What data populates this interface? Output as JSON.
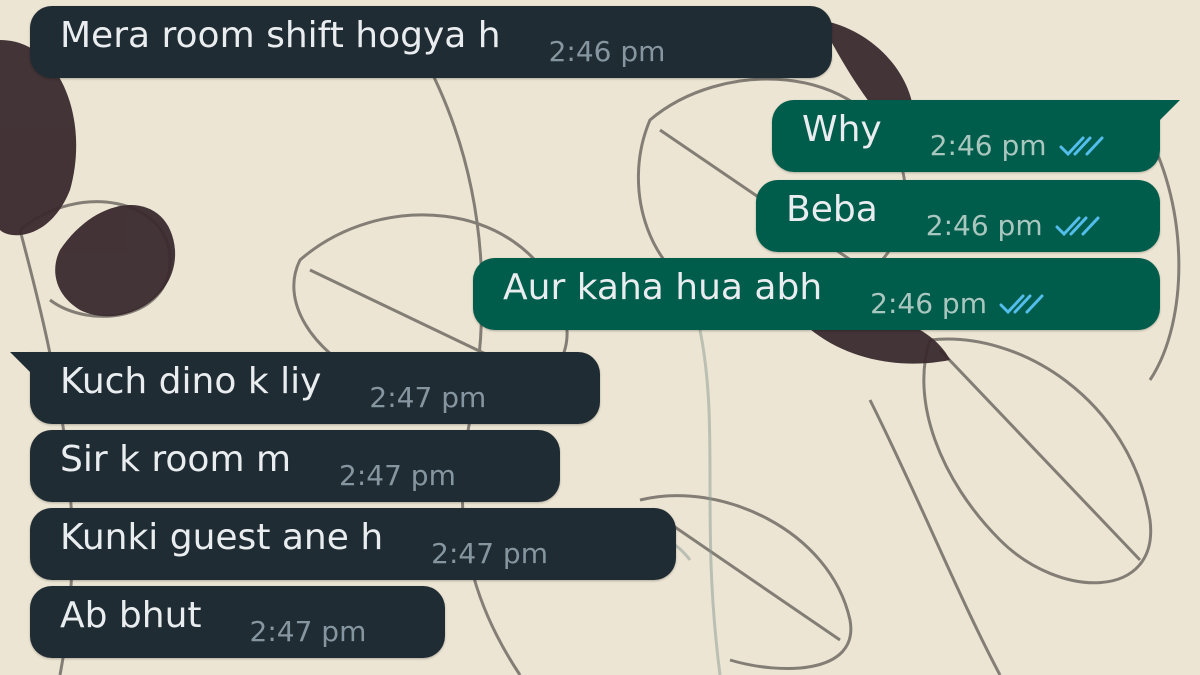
{
  "colors": {
    "wallpaper": "#ece5d3",
    "incoming_bubble": "#202c33",
    "outgoing_bubble": "#005c4b",
    "read_ticks": "#53bdeb"
  },
  "messages": [
    {
      "direction": "incoming",
      "text": "Mera room shift hogya h",
      "time": "2:46 pm"
    },
    {
      "direction": "outgoing",
      "text": "Why",
      "time": "2:46 pm",
      "status_icon": "double-check-read-icon"
    },
    {
      "direction": "outgoing",
      "text": "Beba",
      "time": "2:46 pm",
      "status_icon": "double-check-read-icon"
    },
    {
      "direction": "outgoing",
      "text": "Aur kaha hua abh",
      "time": "2:46 pm",
      "status_icon": "double-check-read-icon"
    },
    {
      "direction": "incoming",
      "text": "Kuch dino k liy",
      "time": "2:47 pm"
    },
    {
      "direction": "incoming",
      "text": "Sir k room m",
      "time": "2:47 pm"
    },
    {
      "direction": "incoming",
      "text": "Kunki guest ane h",
      "time": "2:47 pm"
    },
    {
      "direction": "incoming",
      "text": "Ab bhut",
      "time": "2:47 pm"
    }
  ]
}
